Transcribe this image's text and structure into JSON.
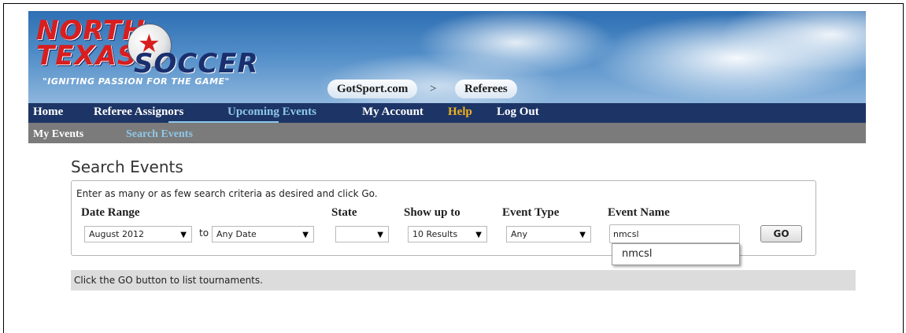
{
  "banner": {
    "logo": {
      "line1": "NORTH",
      "line2": "TEXAS",
      "line3": "SOCCER",
      "tagline": "\"IGNITING PASSION FOR THE GAME\""
    },
    "breadcrumb": {
      "items": [
        "GotSport.com",
        "Referees"
      ],
      "separator": ">"
    }
  },
  "nav": {
    "primary": [
      {
        "label": "Home"
      },
      {
        "label": "Referee Assignors"
      },
      {
        "label": "Upcoming Events",
        "active": true
      },
      {
        "label": "My Account"
      },
      {
        "label": "Help"
      },
      {
        "label": "Log Out"
      }
    ],
    "secondary": [
      {
        "label": "My Events"
      },
      {
        "label": "Search Events",
        "active": true
      }
    ]
  },
  "page": {
    "title": "Search Events"
  },
  "search": {
    "instructions": "Enter as many or as few search criteria as desired and click Go.",
    "labels": {
      "date_range": "Date Range",
      "state": "State",
      "show_up_to": "Show up to",
      "event_type": "Event Type",
      "event_name": "Event Name"
    },
    "date_from": "August 2012",
    "to_label": "to",
    "date_to": "Any Date",
    "state": "",
    "show_up_to": "10 Results",
    "event_type": "Any",
    "event_name": "nmcsl",
    "go_label": "GO",
    "autocomplete": [
      "nmcsl"
    ]
  },
  "status": {
    "message": "Click the GO button to list tournaments."
  },
  "colors": {
    "nav_primary_bg": "#1d3566",
    "nav_secondary_bg": "#7b7b7b",
    "active_link": "#8ec8e8",
    "help_link": "#f2b21b",
    "logo_red": "#d81e1e",
    "logo_navy": "#1a2f6e",
    "status_bg": "#dcdcdc"
  },
  "icons": {
    "dropdown": "chevron-down-icon",
    "logo_star": "star-icon"
  }
}
